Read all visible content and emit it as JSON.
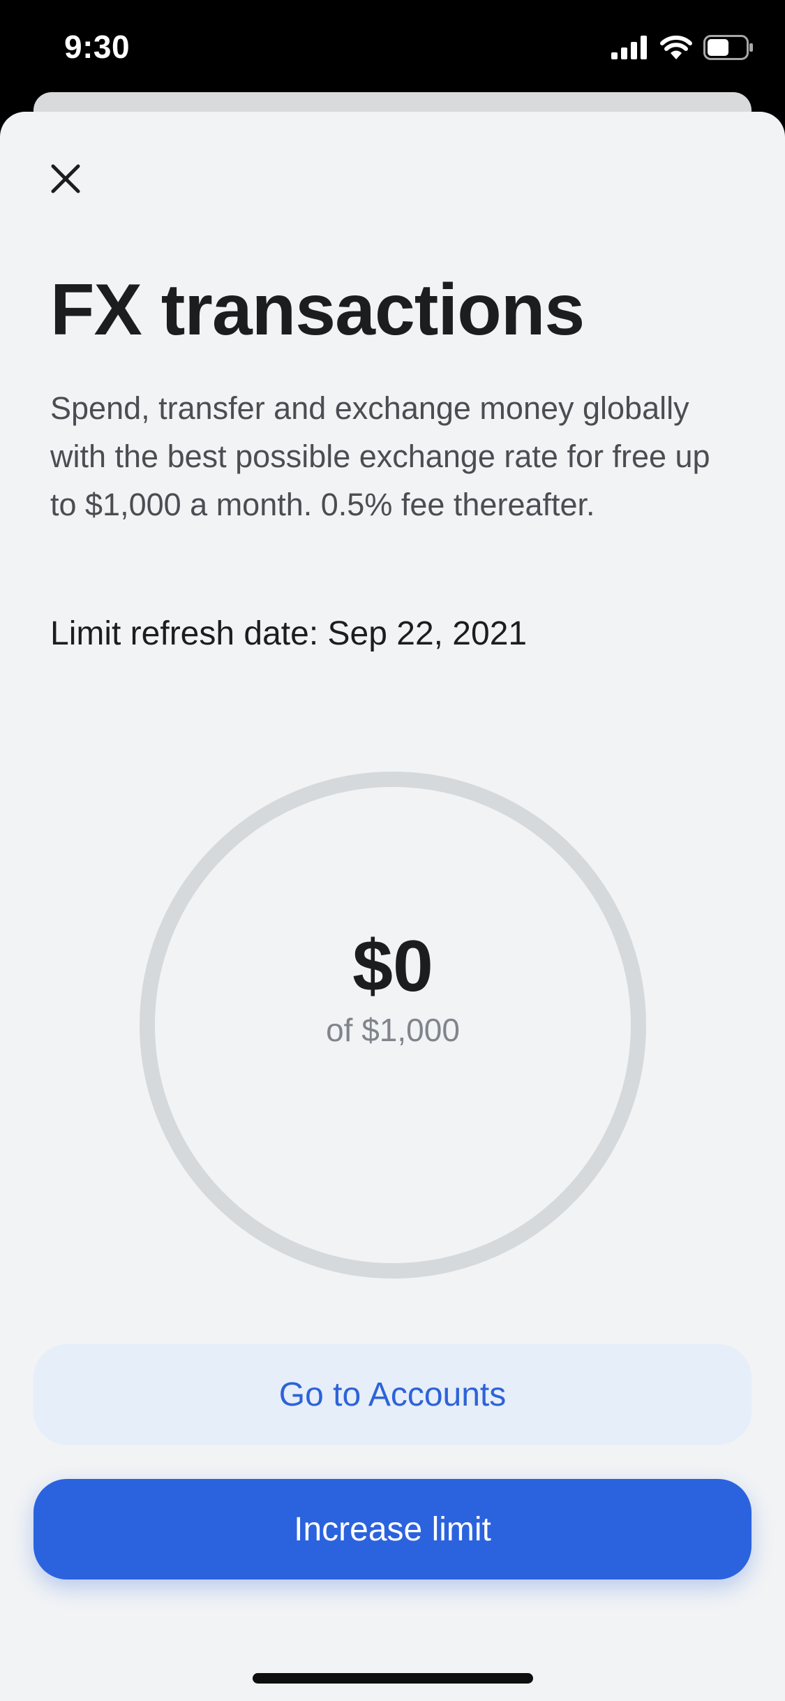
{
  "status_bar": {
    "time": "9:30",
    "icons": [
      "signal-icon",
      "wifi-icon",
      "battery-icon"
    ]
  },
  "sheet": {
    "close_icon": "close-icon",
    "title": "FX transactions",
    "description": "Spend, transfer and exchange money globally with the best possible exchange rate for free up to $1,000 a month. 0.5% fee thereafter.",
    "limit_refresh": "Limit refresh date: Sep 22, 2021"
  },
  "usage": {
    "amount": "$0",
    "of_label": "of $1,000",
    "progress_fraction": 0
  },
  "actions": {
    "secondary_label": "Go to Accounts",
    "primary_label": "Increase limit"
  },
  "colors": {
    "accent": "#2b63de",
    "secondary_bg": "#e6eef9",
    "sheet_bg": "#f1f3f5",
    "ring_track": "#d6d9dc"
  }
}
